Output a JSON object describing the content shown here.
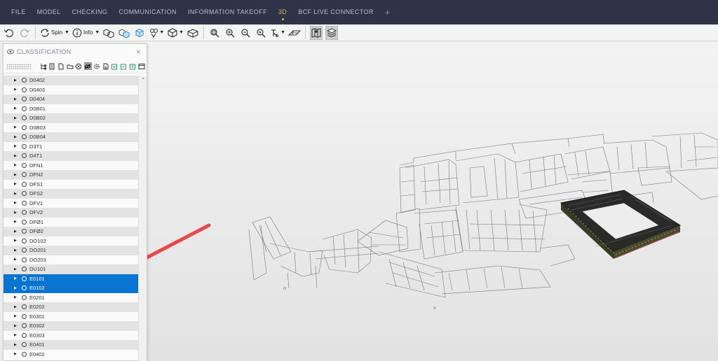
{
  "menu": {
    "items": [
      {
        "label": "FILE",
        "active": false
      },
      {
        "label": "MODEL",
        "active": false
      },
      {
        "label": "CHECKING",
        "active": false
      },
      {
        "label": "COMMUNICATION",
        "active": false
      },
      {
        "label": "INFORMATION TAKEOFF",
        "active": false
      },
      {
        "label": "3D",
        "active": true
      },
      {
        "label": "BCF LIVE CONNECTOR",
        "active": false
      }
    ],
    "add_label": "+"
  },
  "toolbar": {
    "spin_label": "Spin",
    "info_label": "Info"
  },
  "classification": {
    "title": "CLASSIFICATION",
    "close": "×",
    "rows": [
      {
        "label": "D0402",
        "selected": false
      },
      {
        "label": "D0403",
        "selected": false
      },
      {
        "label": "D0404",
        "selected": false
      },
      {
        "label": "D0B01",
        "selected": false
      },
      {
        "label": "D0B02",
        "selected": false
      },
      {
        "label": "D0B03",
        "selected": false
      },
      {
        "label": "D0B04",
        "selected": false
      },
      {
        "label": "D3T1",
        "selected": false
      },
      {
        "label": "D4T1",
        "selected": false
      },
      {
        "label": "DFN1",
        "selected": false
      },
      {
        "label": "DFN2",
        "selected": false
      },
      {
        "label": "DFS1",
        "selected": false
      },
      {
        "label": "DFS2",
        "selected": false
      },
      {
        "label": "DFV1",
        "selected": false
      },
      {
        "label": "DFV2",
        "selected": false
      },
      {
        "label": "DFØ1",
        "selected": false
      },
      {
        "label": "DFØ2",
        "selected": false
      },
      {
        "label": "DO102",
        "selected": false
      },
      {
        "label": "DO201",
        "selected": false
      },
      {
        "label": "DO203",
        "selected": false
      },
      {
        "label": "DU101",
        "selected": false
      },
      {
        "label": "E0101",
        "selected": true
      },
      {
        "label": "E0102",
        "selected": true
      },
      {
        "label": "E0201",
        "selected": false
      },
      {
        "label": "E0202",
        "selected": false
      },
      {
        "label": "E0301",
        "selected": false
      },
      {
        "label": "E0302",
        "selected": false
      },
      {
        "label": "E0303",
        "selected": false
      },
      {
        "label": "E0401",
        "selected": false
      },
      {
        "label": "E0402",
        "selected": false
      }
    ]
  },
  "colors": {
    "menubar": "#2e3448",
    "active_tab": "#f0b43c",
    "selection": "#0a74d1",
    "arrow": "#e8484a",
    "highlight_model": "#2a2a2a"
  }
}
